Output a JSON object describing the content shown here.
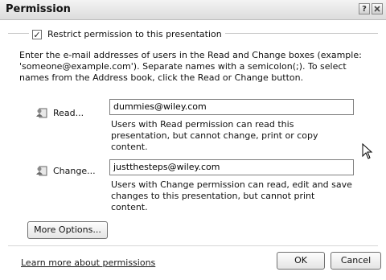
{
  "window": {
    "title": "Permission",
    "help_glyph": "?"
  },
  "restrict": {
    "checked": true,
    "check_glyph": "✓",
    "label": "Restrict permission to this presentation"
  },
  "instructions": "Enter the e-mail addresses of users in the Read and Change boxes (example: 'someone@example.com'). Separate names with a semicolon(;). To select names from the Address book, click the Read or Change button.",
  "read": {
    "button_label": "Read...",
    "value": "dummies@wiley.com",
    "description": "Users with Read permission can read this presentation, but cannot change, print or copy content."
  },
  "change": {
    "button_label": "Change...",
    "value": "justthesteps@wiley.com",
    "description": "Users with Change permission can read, edit and save changes to this presentation, but cannot print content."
  },
  "buttons": {
    "more_options": "More Options...",
    "ok": "OK",
    "cancel": "Cancel"
  },
  "footer": {
    "learn_more": "Learn more about permissions"
  },
  "icons": {
    "address_book": "address-book-icon",
    "cursor": "mouse-pointer-icon"
  }
}
